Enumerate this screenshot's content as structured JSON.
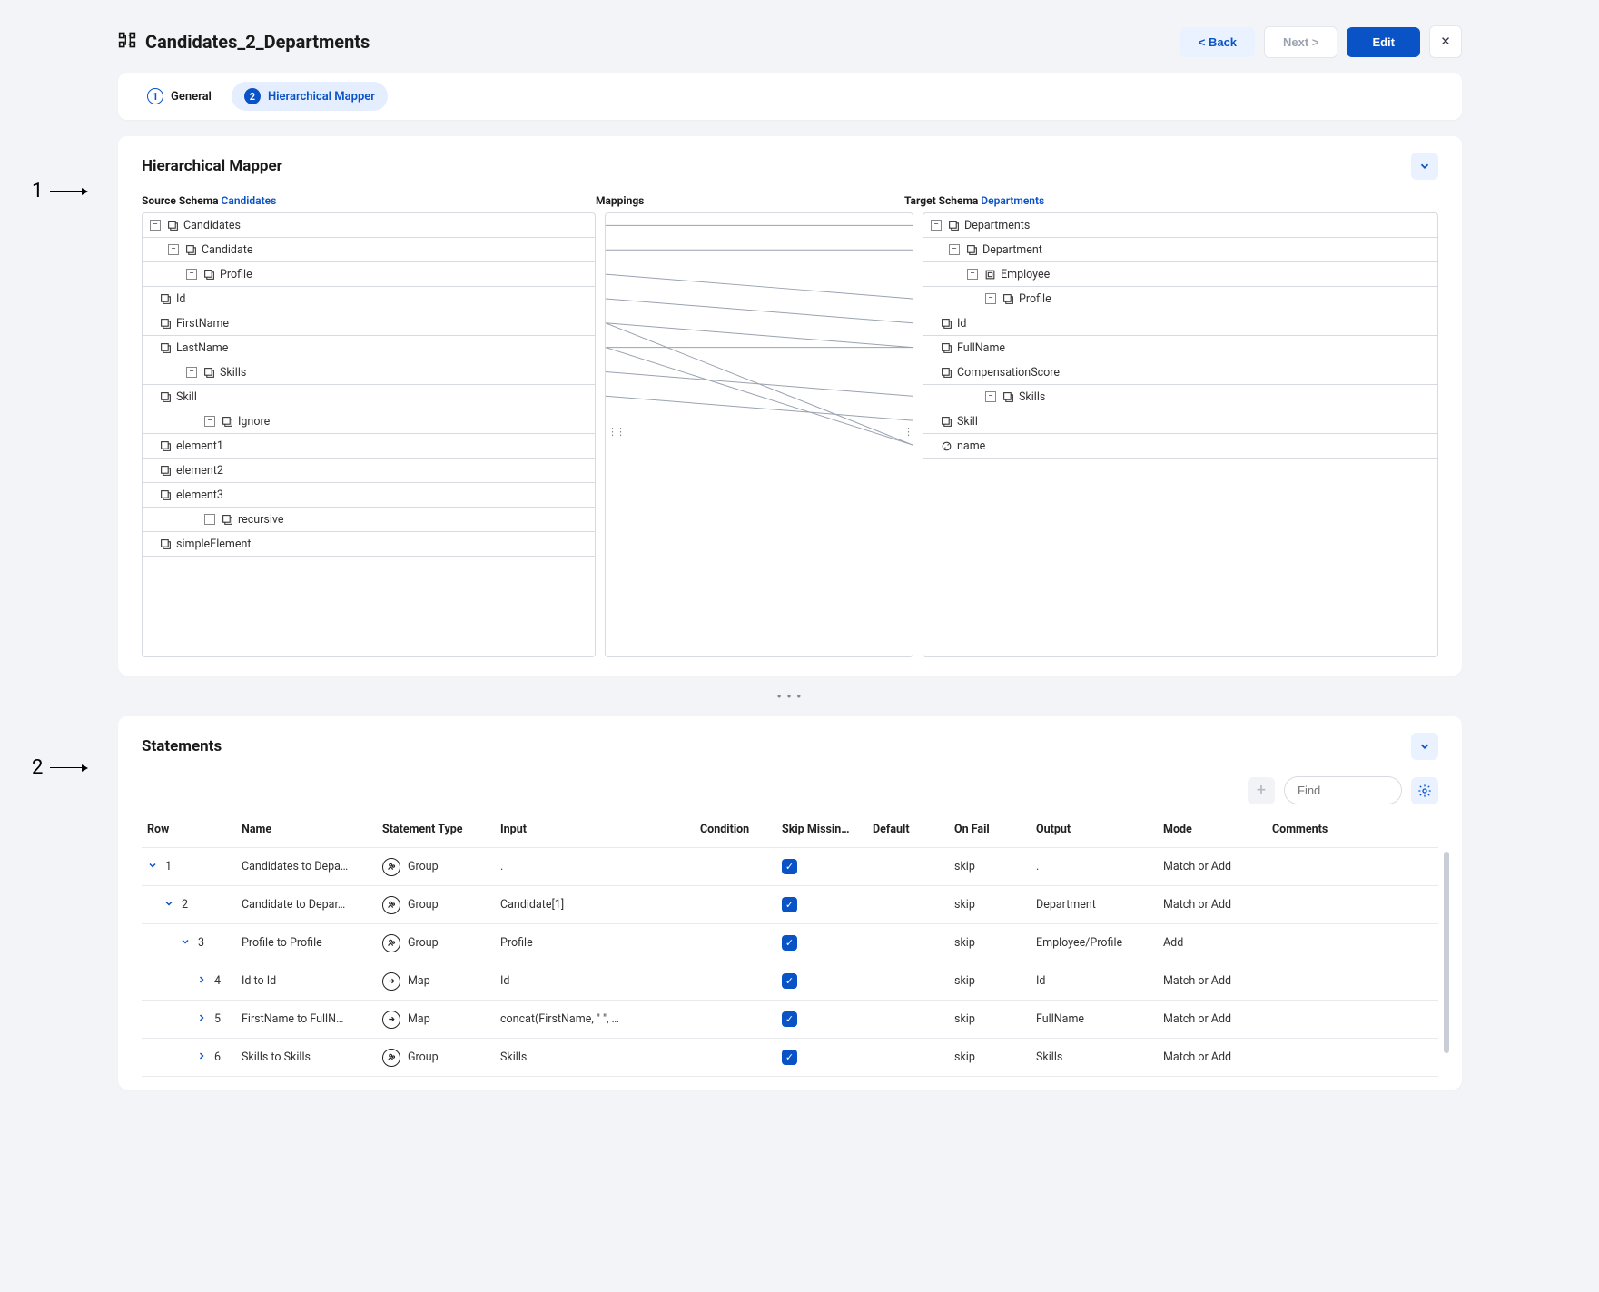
{
  "header": {
    "title": "Candidates_2_Departments",
    "back": "< Back",
    "next": "Next >",
    "edit": "Edit",
    "close": "✕"
  },
  "tabs": [
    {
      "num": "1",
      "label": "General",
      "active": false
    },
    {
      "num": "2",
      "label": "Hierarchical Mapper",
      "active": true
    }
  ],
  "annotations": {
    "one": "1",
    "two": "2"
  },
  "mapper": {
    "title": "Hierarchical Mapper",
    "source_label": "Source Schema",
    "source_link": "Candidates",
    "mappings_label": "Mappings",
    "target_label": "Target Schema",
    "target_link": "Departments",
    "source_tree": [
      {
        "indent": 0,
        "exp": "-",
        "icon": "node",
        "label": "Candidates"
      },
      {
        "indent": 1,
        "exp": "-",
        "icon": "node",
        "label": "Candidate"
      },
      {
        "indent": 2,
        "exp": "-",
        "icon": "node",
        "label": "Profile"
      },
      {
        "indent": 3,
        "exp": "",
        "icon": "leaf",
        "label": "Id"
      },
      {
        "indent": 3,
        "exp": "",
        "icon": "leaf",
        "label": "FirstName"
      },
      {
        "indent": 3,
        "exp": "",
        "icon": "leaf",
        "label": "LastName"
      },
      {
        "indent": 2,
        "exp": "-",
        "icon": "node",
        "label": "Skills"
      },
      {
        "indent": 3,
        "exp": "",
        "icon": "leaf",
        "label": "Skill"
      },
      {
        "indent": 3,
        "exp": "-",
        "icon": "node",
        "label": "Ignore"
      },
      {
        "indent": 4,
        "exp": "",
        "icon": "leaf",
        "label": "element1"
      },
      {
        "indent": 4,
        "exp": "",
        "icon": "leaf",
        "label": "element2"
      },
      {
        "indent": 4,
        "exp": "",
        "icon": "leaf",
        "label": "element3"
      },
      {
        "indent": 3,
        "exp": "-",
        "icon": "node",
        "label": "recursive"
      },
      {
        "indent": 4,
        "exp": "",
        "icon": "leaf",
        "label": "simpleElement"
      }
    ],
    "target_tree": [
      {
        "indent": 0,
        "exp": "-",
        "icon": "node",
        "label": "Departments"
      },
      {
        "indent": 1,
        "exp": "-",
        "icon": "node",
        "label": "Department"
      },
      {
        "indent": 2,
        "exp": "-",
        "icon": "box",
        "label": "Employee"
      },
      {
        "indent": 3,
        "exp": "-",
        "icon": "node",
        "label": "Profile"
      },
      {
        "indent": 4,
        "exp": "",
        "icon": "leaf",
        "label": "Id"
      },
      {
        "indent": 4,
        "exp": "",
        "icon": "leaf",
        "label": "FullName"
      },
      {
        "indent": 4,
        "exp": "",
        "icon": "leaf",
        "label": "CompensationScore"
      },
      {
        "indent": 3,
        "exp": "-",
        "icon": "node",
        "label": "Skills"
      },
      {
        "indent": 4,
        "exp": "",
        "icon": "leaf",
        "label": "Skill"
      },
      {
        "indent": 2,
        "exp": "",
        "icon": "attr",
        "label": "name"
      }
    ],
    "mappings": [
      {
        "from": 0,
        "to": 0
      },
      {
        "from": 1,
        "to": 1
      },
      {
        "from": 2,
        "to": 3
      },
      {
        "from": 3,
        "to": 4
      },
      {
        "from": 4,
        "to": 5
      },
      {
        "from": 5,
        "to": 5
      },
      {
        "from": 4,
        "to": 9
      },
      {
        "from": 5,
        "to": 9
      },
      {
        "from": 6,
        "to": 7
      },
      {
        "from": 7,
        "to": 8
      }
    ]
  },
  "statements": {
    "title": "Statements",
    "find_placeholder": "Find",
    "columns": {
      "row": "Row",
      "name": "Name",
      "type": "Statement Type",
      "input": "Input",
      "condition": "Condition",
      "skip": "Skip Missin…",
      "default": "Default",
      "onfail": "On Fail",
      "output": "Output",
      "mode": "Mode",
      "comments": "Comments"
    },
    "rows": [
      {
        "indent": 0,
        "chev": "down",
        "num": "1",
        "name": "Candidates to Depa…",
        "type": "Group",
        "type_icon": "group",
        "input": ".",
        "skip": true,
        "onfail": "skip",
        "output": ".",
        "mode": "Match or Add"
      },
      {
        "indent": 1,
        "chev": "down",
        "num": "2",
        "name": "Candidate to Depar…",
        "type": "Group",
        "type_icon": "group",
        "input": "Candidate[1]",
        "skip": true,
        "onfail": "skip",
        "output": "Department",
        "mode": "Match or Add"
      },
      {
        "indent": 2,
        "chev": "down",
        "num": "3",
        "name": "Profile to Profile",
        "type": "Group",
        "type_icon": "group",
        "input": "Profile",
        "skip": true,
        "onfail": "skip",
        "output": "Employee/Profile",
        "mode": "Add"
      },
      {
        "indent": 3,
        "chev": "right",
        "num": "4",
        "name": "Id to Id",
        "type": "Map",
        "type_icon": "map",
        "input": "Id",
        "skip": true,
        "onfail": "skip",
        "output": "Id",
        "mode": "Match or Add"
      },
      {
        "indent": 3,
        "chev": "right",
        "num": "5",
        "name": "FirstName to FullN…",
        "type": "Map",
        "type_icon": "map",
        "input": "concat(FirstName, \" \", …",
        "skip": true,
        "onfail": "skip",
        "output": "FullName",
        "mode": "Match or Add"
      },
      {
        "indent": 3,
        "chev": "right",
        "num": "6",
        "name": "Skills to Skills",
        "type": "Group",
        "type_icon": "group",
        "input": "Skills",
        "skip": true,
        "onfail": "skip",
        "output": "Skills",
        "mode": "Match or Add"
      }
    ]
  }
}
